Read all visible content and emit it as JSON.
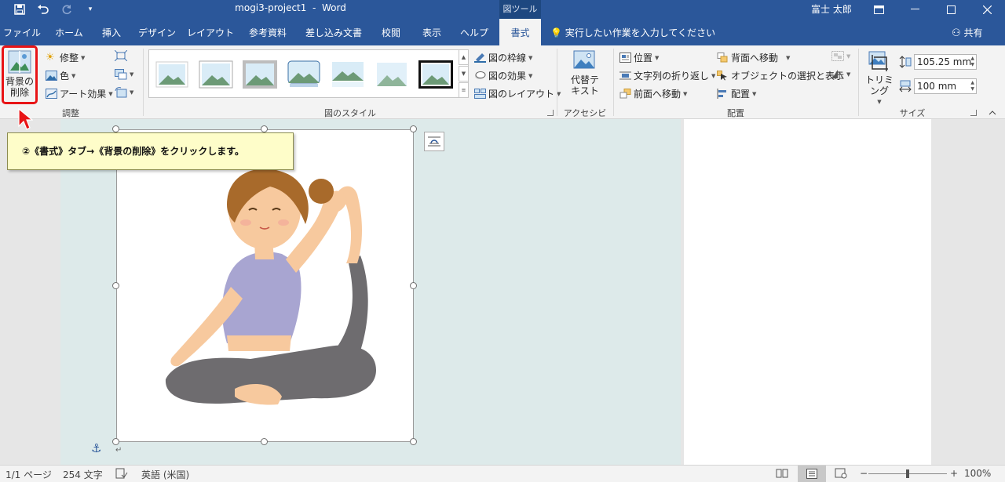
{
  "window": {
    "title": "mogi3-project1  -  Word",
    "contextual_tab_group": "図ツール",
    "user_name": "富士 太郎",
    "icons": [
      "save-icon",
      "undo-icon",
      "redo-icon",
      "customize-qat-icon",
      "ribbon-display-options-icon",
      "minimize-icon",
      "maximize-icon",
      "close-icon"
    ]
  },
  "tabs": [
    "ファイル",
    "ホーム",
    "挿入",
    "デザイン",
    "レイアウト",
    "参考資料",
    "差し込み文書",
    "校閲",
    "表示",
    "ヘルプ",
    "書式"
  ],
  "active_tab": "書式",
  "tell_me": "実行したい作業を入力してください",
  "share": "共有",
  "ribbon": {
    "adjust": {
      "remove_bg_line1": "背景の",
      "remove_bg_line2": "削除",
      "corrections": "修整",
      "color": "色",
      "artistic": "アート効果",
      "label": "調整"
    },
    "picture_styles": {
      "border": "図の枠線",
      "effects": "図の効果",
      "layout": "図のレイアウト",
      "label": "図のスタイル"
    },
    "accessibility": {
      "alt_text_line1": "代替テ",
      "alt_text_line2": "キスト",
      "label": "アクセシビリ…"
    },
    "arrange": {
      "position": "位置",
      "wrap_text": "文字列の折り返し",
      "bring_forward": "前面へ移動",
      "send_backward": "背面へ移動",
      "selection_pane": "オブジェクトの選択と表示",
      "align": "配置",
      "label": "配置"
    },
    "size": {
      "crop": "トリミング",
      "height": "105.25 mm",
      "width": "100 mm",
      "label": "サイズ"
    }
  },
  "callout": "②《書式》タブ→《背景の削除》をクリックします。",
  "status_bar": {
    "page": "1/1 ページ",
    "words": "254 文字",
    "language": "英語 (米国)",
    "zoom_minus": "−",
    "zoom_plus": "+",
    "zoom": "100%"
  },
  "colors": {
    "brand": "#2b579a",
    "highlight": "#e81416",
    "callout_bg": "#fefdc9"
  }
}
